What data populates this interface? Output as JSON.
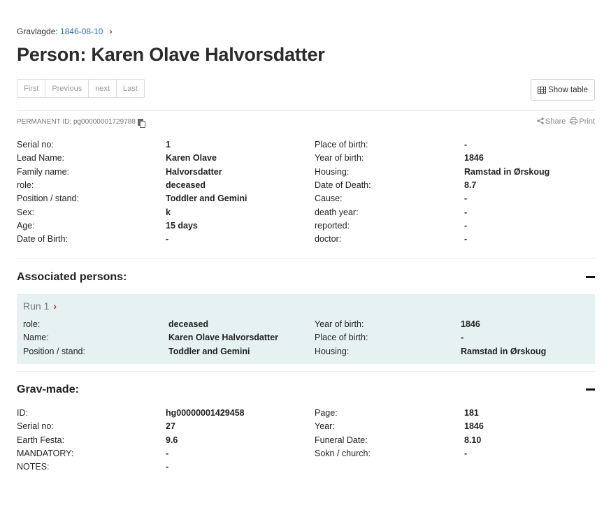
{
  "breadcrumb": {
    "label": "Gravlagde:",
    "link": "1846-08-10",
    "chevron": "›"
  },
  "title": "Person: Karen Olave Halvorsdatter",
  "pager": {
    "first": "First",
    "previous": "Previous",
    "next": "next",
    "last": "Last"
  },
  "show_table": "Show table",
  "permanent_id": "PERMANENT ID: pg00000001729788",
  "actions": {
    "share": "Share",
    "print": "Print",
    "share_icon": "share-icon",
    "print_icon": "print-icon"
  },
  "details": {
    "left": [
      {
        "label": "Serial no:",
        "value": "1"
      },
      {
        "label": "Lead Name:",
        "value": "Karen Olave"
      },
      {
        "label": "Family name:",
        "value": "Halvorsdatter"
      },
      {
        "label": "role:",
        "value": "deceased"
      },
      {
        "label": "Position / stand:",
        "value": "Toddler and Gemini"
      },
      {
        "label": "Sex:",
        "value": "k"
      },
      {
        "label": "Age:",
        "value": "15 days"
      },
      {
        "label": "Date of Birth:",
        "value": "-"
      }
    ],
    "right": [
      {
        "label": "Place of birth:",
        "value": "-"
      },
      {
        "label": "Year of birth:",
        "value": "1846"
      },
      {
        "label": "Housing:",
        "value": "Ramstad in Ørskoug"
      },
      {
        "label": "Date of Death:",
        "value": "8.7"
      },
      {
        "label": "Cause:",
        "value": "-"
      },
      {
        "label": "death year:",
        "value": "-"
      },
      {
        "label": "reported:",
        "value": "-"
      },
      {
        "label": "doctor:",
        "value": "-"
      }
    ]
  },
  "associated": {
    "title": "Associated persons:",
    "run_title": "Run 1",
    "run_chevron": "›",
    "left": [
      {
        "label": "role:",
        "value": "deceased"
      },
      {
        "label": "Name:",
        "value": "Karen Olave Halvorsdatter"
      },
      {
        "label": "Position / stand:",
        "value": "Toddler and Gemini"
      }
    ],
    "right": [
      {
        "label": "Year of birth:",
        "value": "1846"
      },
      {
        "label": "Place of birth:",
        "value": "-"
      },
      {
        "label": "Housing:",
        "value": "Ramstad in Ørskoug"
      }
    ]
  },
  "grav": {
    "title": "Grav-made:",
    "left": [
      {
        "label": "ID:",
        "value": "hg00000001429458"
      },
      {
        "label": "Serial no:",
        "value": "27"
      },
      {
        "label": "Earth Festa:",
        "value": "9.6"
      },
      {
        "label": "MANDATORY:",
        "value": "-"
      },
      {
        "label": "NOTES:",
        "value": "-"
      }
    ],
    "right": [
      {
        "label": "Page:",
        "value": "181"
      },
      {
        "label": "Year:",
        "value": "1846"
      },
      {
        "label": "Funeral Date:",
        "value": "8.10"
      },
      {
        "label": "Sokn / church:",
        "value": "-"
      }
    ]
  }
}
